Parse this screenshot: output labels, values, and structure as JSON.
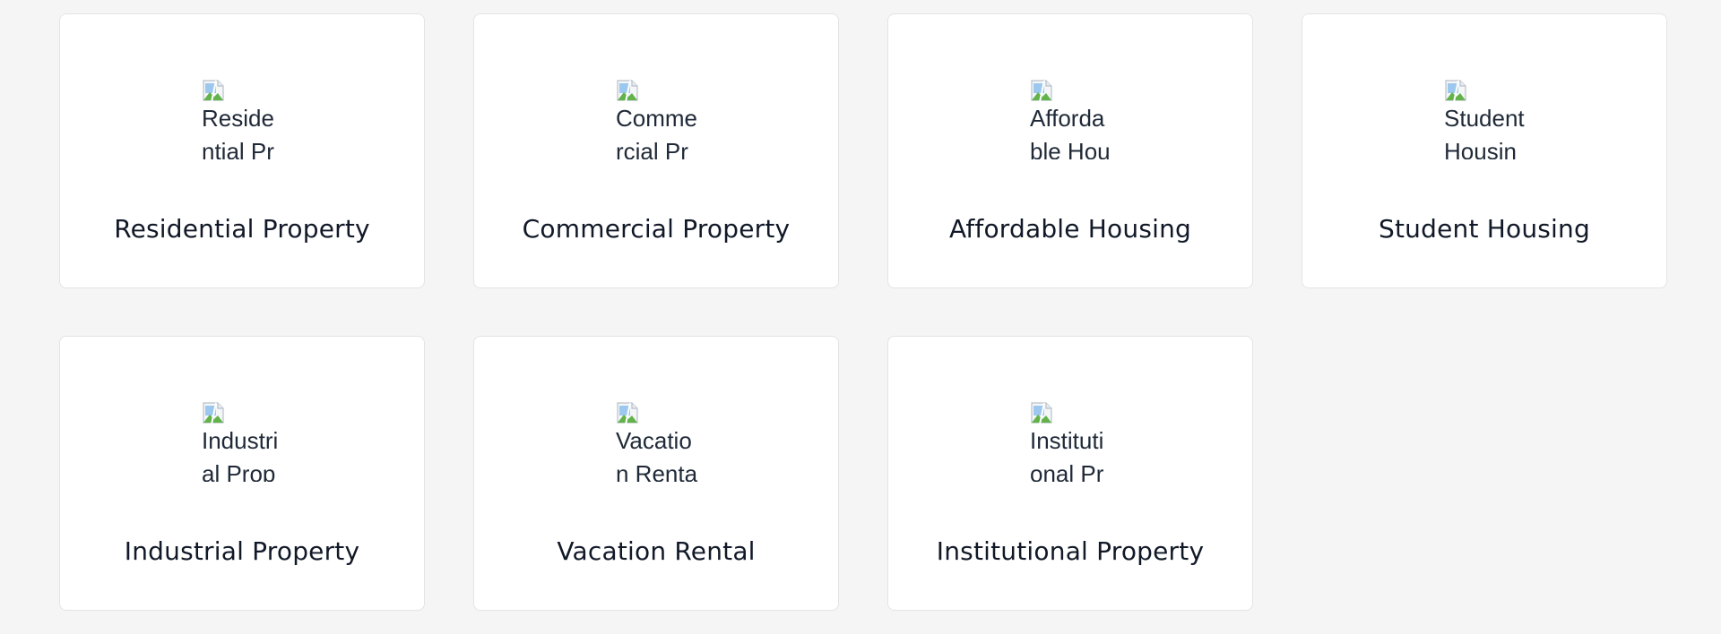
{
  "categories": [
    {
      "title": "Residential Property",
      "image_alt": "Residential Property"
    },
    {
      "title": "Commercial Property",
      "image_alt": "Commercial Property"
    },
    {
      "title": "Affordable Housing",
      "image_alt": "Affordable Housing"
    },
    {
      "title": "Student Housing",
      "image_alt": "Student Housing"
    },
    {
      "title": "Industrial Property",
      "image_alt": "Industrial Property"
    },
    {
      "title": "Vacation Rental",
      "image_alt": "Vacation Rental"
    },
    {
      "title": "Institutional Property",
      "image_alt": "Institutional Property"
    }
  ],
  "icons": {
    "image_placeholder": "broken-image-icon"
  },
  "colors": {
    "background": "#f5f5f6",
    "card_background": "#ffffff",
    "card_border": "#e3e4e7",
    "title_text": "#111827"
  }
}
